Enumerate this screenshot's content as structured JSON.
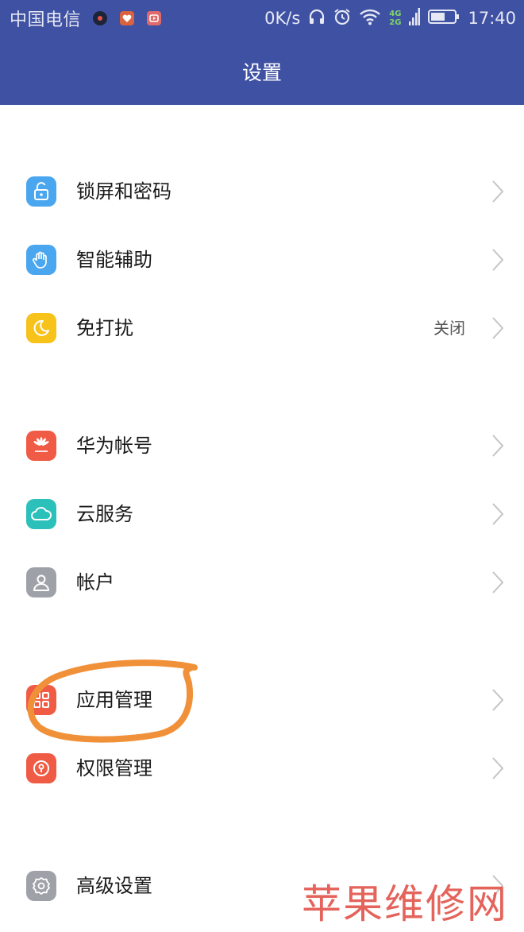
{
  "status_bar": {
    "carrier": "中国电信",
    "speed": "0K/s",
    "network_4g": "4G",
    "network_2g": "2G",
    "time": "17:40"
  },
  "header": {
    "title": "设置"
  },
  "groups": [
    {
      "items": [
        {
          "label": "锁屏和密码",
          "icon": "lock-icon",
          "icon_color": "#4aa6ee"
        },
        {
          "label": "智能辅助",
          "icon": "hand-icon",
          "icon_color": "#4aa6ee"
        },
        {
          "label": "免打扰",
          "icon": "moon-icon",
          "icon_color": "#f7c21a",
          "value": "关闭"
        }
      ]
    },
    {
      "items": [
        {
          "label": "华为帐号",
          "icon": "huawei-icon",
          "icon_color": "#ef5b44"
        },
        {
          "label": "云服务",
          "icon": "cloud-icon",
          "icon_color": "#2bc0b9"
        },
        {
          "label": "帐户",
          "icon": "person-icon",
          "icon_color": "#9ea2a8"
        }
      ]
    },
    {
      "items": [
        {
          "label": "应用管理",
          "icon": "apps-grid-icon",
          "icon_color": "#ef5b44"
        },
        {
          "label": "权限管理",
          "icon": "keyhole-icon",
          "icon_color": "#ef5b44"
        }
      ]
    },
    {
      "items": [
        {
          "label": "高级设置",
          "icon": "gear-icon",
          "icon_color": "#9ea2a8"
        }
      ]
    }
  ],
  "annotation_color": "#f0913a",
  "watermark": "苹果维修网"
}
